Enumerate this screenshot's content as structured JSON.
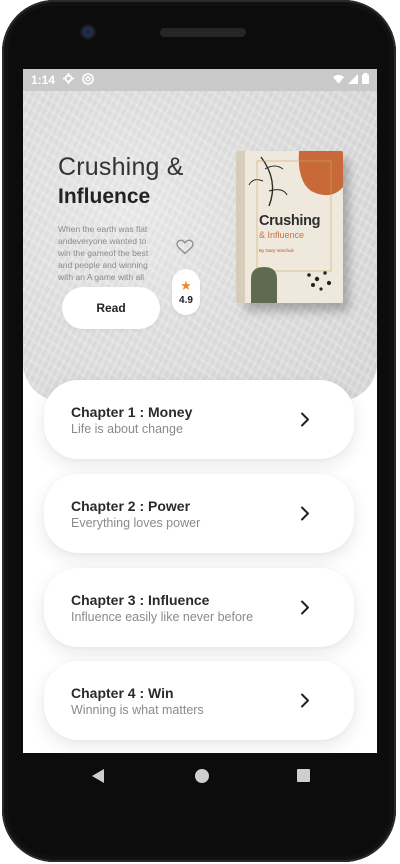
{
  "status_bar": {
    "time": "1:14",
    "icons": [
      "settings-icon",
      "at-sign-icon",
      "wifi-icon",
      "signal-icon",
      "battery-icon"
    ]
  },
  "book": {
    "title_line1": "Crushing &",
    "title_line2": "Influence",
    "description": "When the earth was flat andeveryone wanted to win the gameof the best and people and winning with an A game with all",
    "rating": "4.9",
    "read_label": "Read",
    "cover": {
      "title": "Crushing",
      "subtitle": "& Influence",
      "author": "By Gary Venchuk"
    }
  },
  "chapters": [
    {
      "title": "Chapter 1 : Money",
      "subtitle": "Life is about change"
    },
    {
      "title": "Chapter 2 : Power",
      "subtitle": "Everything loves power"
    },
    {
      "title": "Chapter 3 : Influence",
      "subtitle": "Influence easily like never before"
    },
    {
      "title": "Chapter 4 : Win",
      "subtitle": "Winning is what matters"
    }
  ],
  "colors": {
    "accent_star": "#f08a24",
    "cover_orange": "#c8693a",
    "cover_green": "#5f6b4f"
  }
}
